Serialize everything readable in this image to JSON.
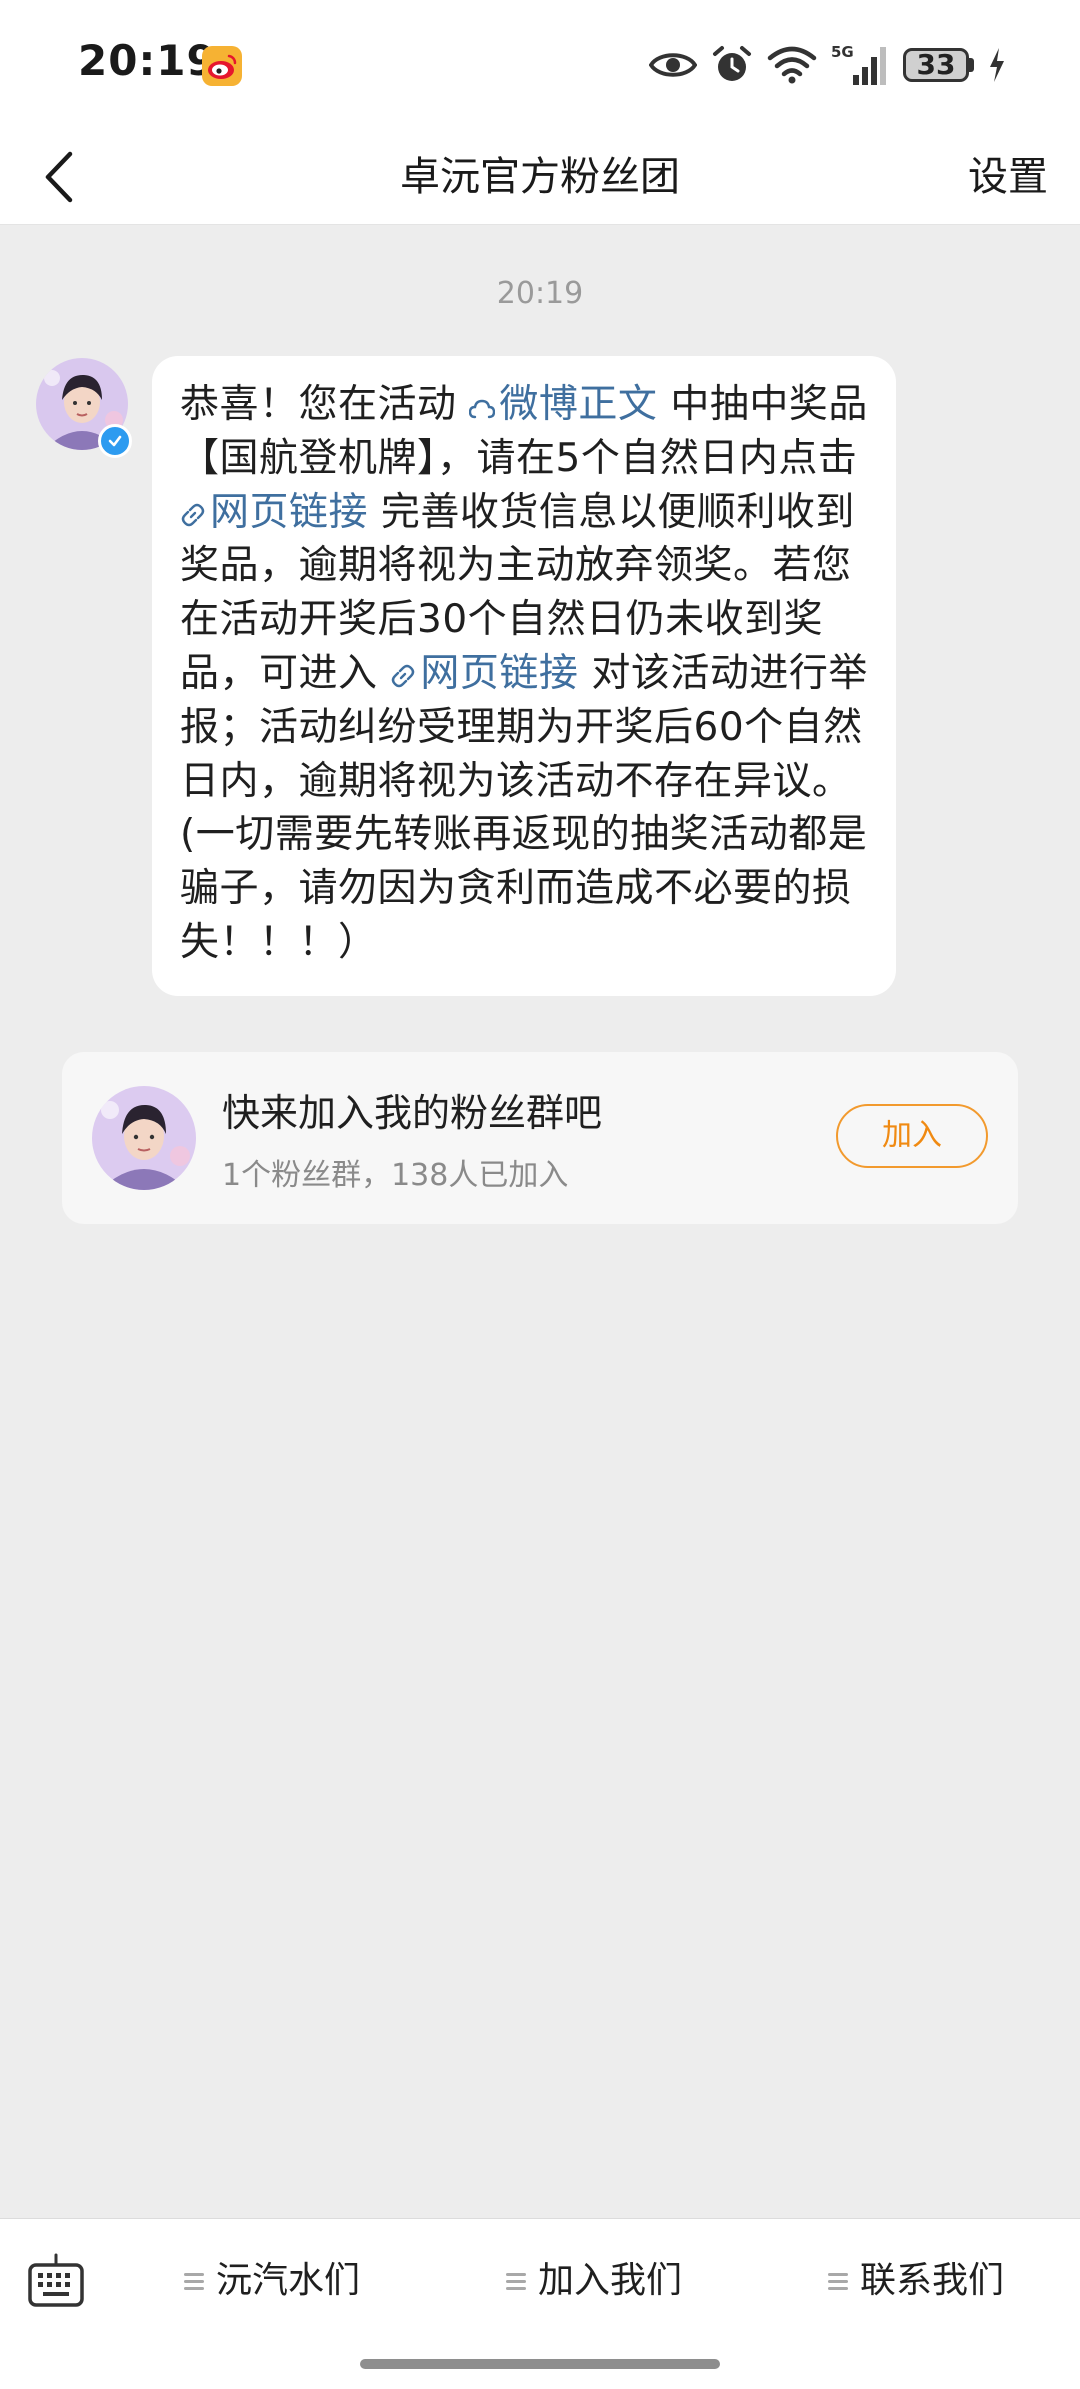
{
  "status_bar": {
    "time": "20:19",
    "battery": "33"
  },
  "header": {
    "title": "卓沅官方粉丝团",
    "settings_label": "设置"
  },
  "chat": {
    "timestamp": "20:19",
    "message": {
      "part1": "恭喜！您在活动 ",
      "link_weibo": "微博正文",
      "part2": " 中抽中奖品【国航登机牌】，请在5个自然日内点击 ",
      "link_web1": "网页链接",
      "part3": " 完善收货信息以便顺利收到奖品，逾期将视为主动放弃领奖。若您在活动开奖后30个自然日仍未收到奖品，可进入 ",
      "link_web2": "网页链接",
      "part4": " 对该活动进行举报；活动纠纷受理期为开奖后60个自然日内，逾期将视为该活动不存在异议。(一切需要先转账再返现的抽奖活动都是骗子，请勿因为贪利而造成不必要的损失！！！）"
    }
  },
  "fan_group": {
    "title": "快来加入我的粉丝群吧",
    "subtitle": "1个粉丝群，138人已加入",
    "join_label": "加入"
  },
  "bottom_menu": {
    "items": [
      {
        "label": "沅汽水们"
      },
      {
        "label": "加入我们"
      },
      {
        "label": "联系我们"
      }
    ]
  },
  "colors": {
    "accent_link": "#3f6f9f",
    "join_orange": "#f08a12",
    "verified_blue": "#2d9bf0"
  }
}
